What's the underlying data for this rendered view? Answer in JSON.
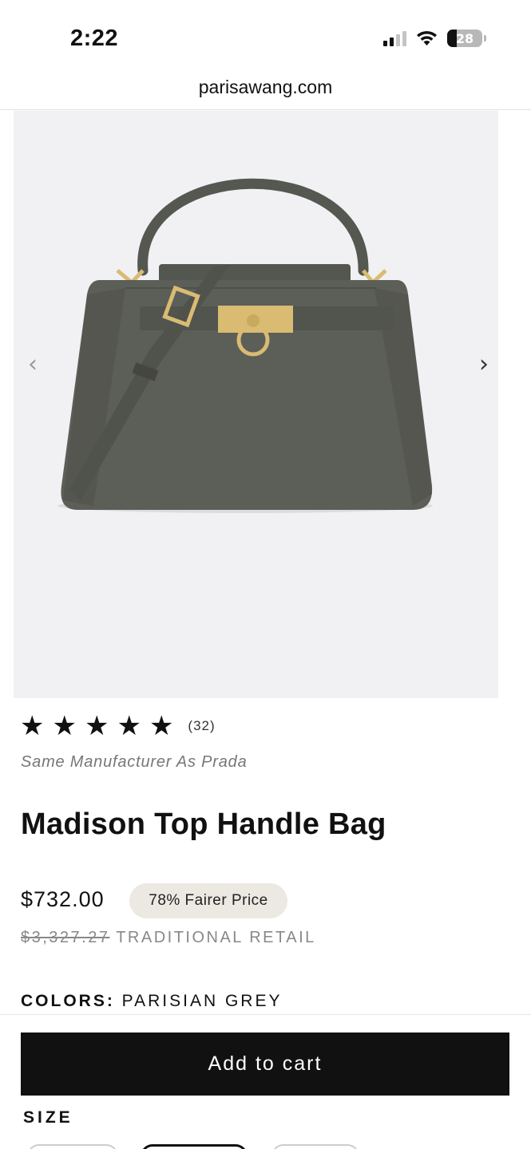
{
  "status_bar": {
    "time": "2:22",
    "battery": "28",
    "icons": [
      "signal-icon",
      "wifi-icon",
      "battery-icon"
    ]
  },
  "browser": {
    "url": "parisawang.com"
  },
  "gallery": {
    "prev_icon": "chevron-left-icon",
    "next_icon": "chevron-right-icon",
    "prev_glyph": "‹",
    "next_glyph": "›",
    "image": "grey-top-handle-bag-image"
  },
  "product": {
    "stars": [
      "★",
      "★",
      "★",
      "★",
      "★"
    ],
    "review_count": "(32)",
    "tagline": "Same Manufacturer As Prada",
    "title": "Madison Top Handle Bag",
    "price": "$732.00",
    "badge": "78% Fairer Price",
    "retail_price": "$3,327.27",
    "retail_label": "TRADITIONAL RETAIL",
    "colors_label": "COLORS:",
    "colors_value": "PARISIAN GREY"
  },
  "actions": {
    "add_to_cart": "Add to cart"
  },
  "size": {
    "label": "SIZE"
  },
  "colors": {
    "bag": "#5c5e58",
    "hardware": "#d9bb72",
    "gallery_bg": "#f1f1f3",
    "badge_bg": "#ece8e2",
    "button_bg": "#111111"
  }
}
